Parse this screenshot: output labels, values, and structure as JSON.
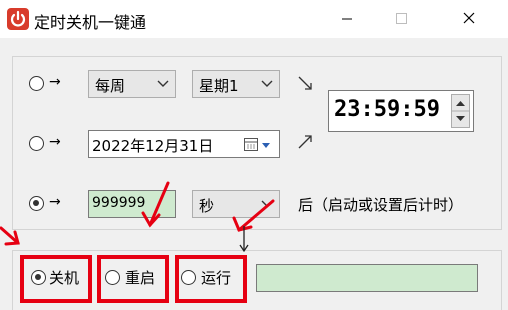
{
  "window": {
    "title": "定时关机一键通",
    "icons": {
      "app": "power-icon",
      "minimize": "minimize-icon",
      "maximize": "maximize-icon",
      "close": "close-icon"
    }
  },
  "schedule": {
    "row1": {
      "arrow": "→",
      "period": "每周",
      "weekday": "星期1"
    },
    "row2": {
      "arrow": "→",
      "date": "2022年12月31日"
    },
    "time": "23:59:59",
    "row3": {
      "arrow": "→",
      "amount": "999999",
      "unit": "秒",
      "suffix": "后（启动或设置后计时）"
    }
  },
  "actions": {
    "shutdown": "关机",
    "restart": "重启",
    "run": "运行",
    "run_path": ""
  },
  "colors": {
    "highlight": "#e60012",
    "green_field": "#cfeacf"
  }
}
